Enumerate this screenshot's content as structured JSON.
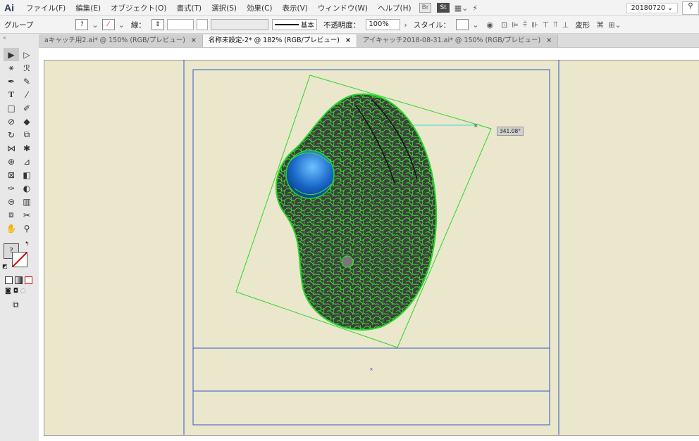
{
  "menubar": {
    "app_logo": "Ai",
    "items": [
      "ファイル(F)",
      "編集(E)",
      "オブジェクト(O)",
      "書式(T)",
      "選択(S)",
      "効果(C)",
      "表示(V)",
      "ウィンドウ(W)",
      "ヘルプ(H)"
    ],
    "bridge_icon": "Br",
    "stock_icon": "St",
    "workspace": "20180720 ⌄"
  },
  "control_bar": {
    "selection_label": "グループ",
    "stroke_label": "線：",
    "stroke_profile": "基本",
    "opacity_label": "不透明度：",
    "opacity_value": "100%",
    "style_label": "スタイル：",
    "transform_label": "変形"
  },
  "tabs": [
    {
      "label": "aキャッチ用2.ai* @ 150% (RGB/プレビュー)",
      "active": false
    },
    {
      "label": "名称未設定-2* @ 182% (RGB/プレビュー)",
      "active": true
    },
    {
      "label": "アイキャッチ2018-08-31.ai* @ 150% (RGB/プレビュー)",
      "active": false
    }
  ],
  "canvas": {
    "angle_readout": "341.08°",
    "artboard_color": "#ebe7cc",
    "guide_color": "#2e59c6",
    "selection_color": "#27d62a"
  },
  "tools_icons": [
    "selection-icon",
    "direct-selection-icon",
    "magic-wand-icon",
    "lasso-icon",
    "pen-icon",
    "curvature-icon",
    "type-icon",
    "line-icon",
    "rectangle-icon",
    "paintbrush-icon",
    "shaper-icon",
    "eraser-icon",
    "rotate-icon",
    "scale-icon",
    "width-icon",
    "puppet-warp-icon",
    "shape-builder-icon",
    "perspective-icon",
    "mesh-icon",
    "gradient-icon",
    "eyedropper-icon",
    "blend-icon",
    "symbol-sprayer-icon",
    "graph-icon",
    "artboard-icon",
    "slice-icon",
    "hand-icon",
    "zoom-icon"
  ]
}
